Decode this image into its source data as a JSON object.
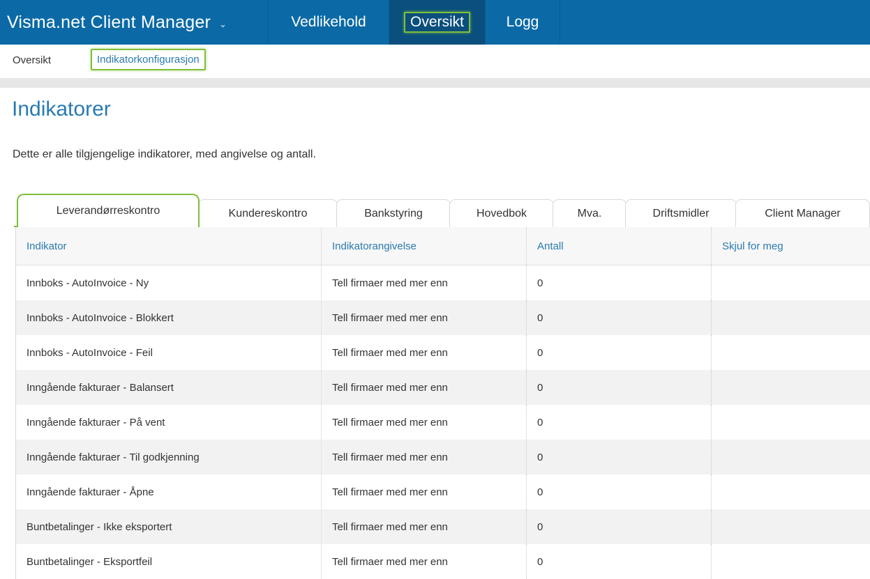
{
  "topbar": {
    "app_title": "Visma.net Client Manager",
    "chevron_icon": "chevron-down-icon",
    "nav": [
      "Vedlikehold",
      "Oversikt",
      "Logg"
    ]
  },
  "subnav": {
    "items": [
      "Oversikt",
      "Indikatorkonfigurasjon"
    ]
  },
  "main": {
    "title": "Indikatorer",
    "description": "Dette er alle tilgjengelige indikatorer, med angivelse og antall.",
    "tabs": [
      "Leverandørreskontro",
      "Kundereskontro",
      "Bankstyring",
      "Hovedbok",
      "Mva.",
      "Driftsmidler",
      "Client Manager"
    ],
    "active_tab": "Leverandørreskontro",
    "table": {
      "headers": [
        "Indikator",
        "Indikatorangivelse",
        "Antall",
        "Skjul for meg"
      ],
      "rows": [
        [
          "Innboks - AutoInvoice - Ny",
          "Tell firmaer med mer enn",
          "0",
          ""
        ],
        [
          "Innboks - AutoInvoice - Blokkert",
          "Tell firmaer med mer enn",
          "0",
          ""
        ],
        [
          "Innboks - AutoInvoice - Feil",
          "Tell firmaer med mer enn",
          "0",
          ""
        ],
        [
          "Inngående fakturaer - Balansert",
          "Tell firmaer med mer enn",
          "0",
          ""
        ],
        [
          "Inngående fakturaer - På vent",
          "Tell firmaer med mer enn",
          "0",
          ""
        ],
        [
          "Inngående fakturaer - Til godkjenning",
          "Tell firmaer med mer enn",
          "0",
          ""
        ],
        [
          "Inngående fakturaer - Åpne",
          "Tell firmaer med mer enn",
          "0",
          ""
        ],
        [
          "Buntbetalinger - Ikke eksportert",
          "Tell firmaer med mer enn",
          "0",
          ""
        ],
        [
          "Buntbetalinger - Eksportfeil",
          "Tell firmaer med mer enn",
          "0",
          ""
        ]
      ]
    }
  },
  "colors": {
    "topbar": "#0b6aa6",
    "accent_link": "#2a7ab0",
    "highlight": "#7fbf3a"
  }
}
